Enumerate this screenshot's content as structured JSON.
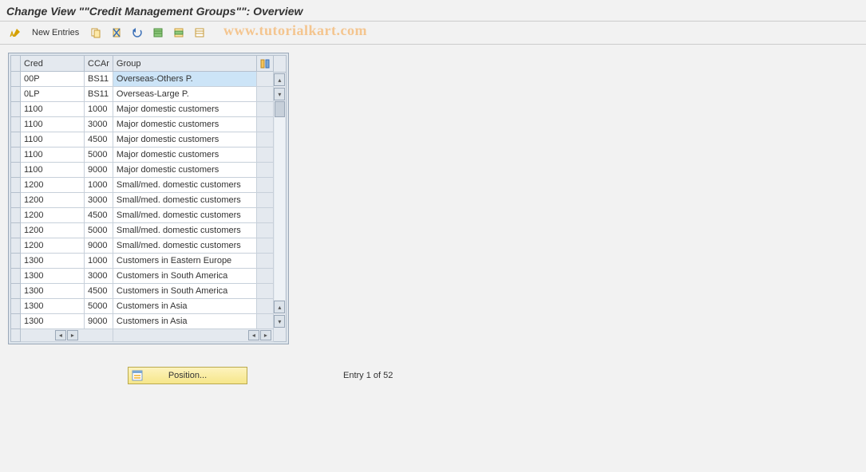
{
  "title": "Change View \"\"Credit Management Groups\"\": Overview",
  "watermark": "www.tutorialkart.com",
  "toolbar": {
    "new_entries_label": "New Entries"
  },
  "table": {
    "headers": {
      "cred": "Cred",
      "ccar": "CCAr",
      "group": "Group"
    },
    "rows": [
      {
        "cred": "00P",
        "ccar": "BS11",
        "group": "Overseas-Others P.",
        "selected": true
      },
      {
        "cred": "0LP",
        "ccar": "BS11",
        "group": "Overseas-Large P."
      },
      {
        "cred": "1100",
        "ccar": "1000",
        "group": "Major domestic customers"
      },
      {
        "cred": "1100",
        "ccar": "3000",
        "group": "Major domestic customers"
      },
      {
        "cred": "1100",
        "ccar": "4500",
        "group": "Major domestic customers"
      },
      {
        "cred": "1100",
        "ccar": "5000",
        "group": "Major domestic customers"
      },
      {
        "cred": "1100",
        "ccar": "9000",
        "group": "Major domestic customers"
      },
      {
        "cred": "1200",
        "ccar": "1000",
        "group": "Small/med. domestic customers"
      },
      {
        "cred": "1200",
        "ccar": "3000",
        "group": "Small/med. domestic customers"
      },
      {
        "cred": "1200",
        "ccar": "4500",
        "group": "Small/med. domestic customers"
      },
      {
        "cred": "1200",
        "ccar": "5000",
        "group": "Small/med. domestic customers"
      },
      {
        "cred": "1200",
        "ccar": "9000",
        "group": "Small/med. domestic customers"
      },
      {
        "cred": "1300",
        "ccar": "1000",
        "group": "Customers in Eastern Europe"
      },
      {
        "cred": "1300",
        "ccar": "3000",
        "group": "Customers in South America"
      },
      {
        "cred": "1300",
        "ccar": "4500",
        "group": "Customers in South America"
      },
      {
        "cred": "1300",
        "ccar": "5000",
        "group": "Customers in Asia"
      },
      {
        "cred": "1300",
        "ccar": "9000",
        "group": "Customers in Asia"
      }
    ]
  },
  "footer": {
    "position_label": "Position...",
    "entry_status": "Entry 1 of 52"
  },
  "colors": {
    "header_bg": "#e4e9ef",
    "border": "#b5c0cd",
    "selected_cell": "#cce4f7",
    "position_btn_bg": "#f6e68a"
  }
}
